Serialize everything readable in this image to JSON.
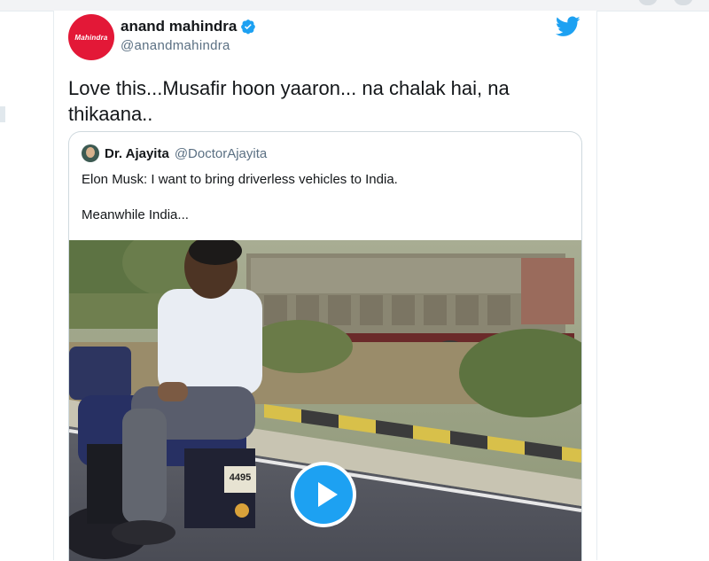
{
  "tweet": {
    "avatar_logo_text": "Mahindra",
    "display_name": "anand mahindra",
    "handle": "@anandmahindra",
    "text_line1": "Love this...Musafir hoon yaaron... na chalak hai, na",
    "text_line2": "thikaana.."
  },
  "quoted_tweet": {
    "display_name": "Dr. Ajayita",
    "handle": "@DoctorAjayita",
    "text_line1": "Elon Musk: I want to bring driverless vehicles to India.",
    "text_line2": "Meanwhile India..."
  },
  "video": {
    "plate_text": "4495",
    "play_icon": "play-icon"
  },
  "colors": {
    "twitter_blue": "#1da1f2",
    "mahindra_red": "#e31837",
    "text_primary": "#14171a",
    "text_secondary": "#5b7083"
  }
}
